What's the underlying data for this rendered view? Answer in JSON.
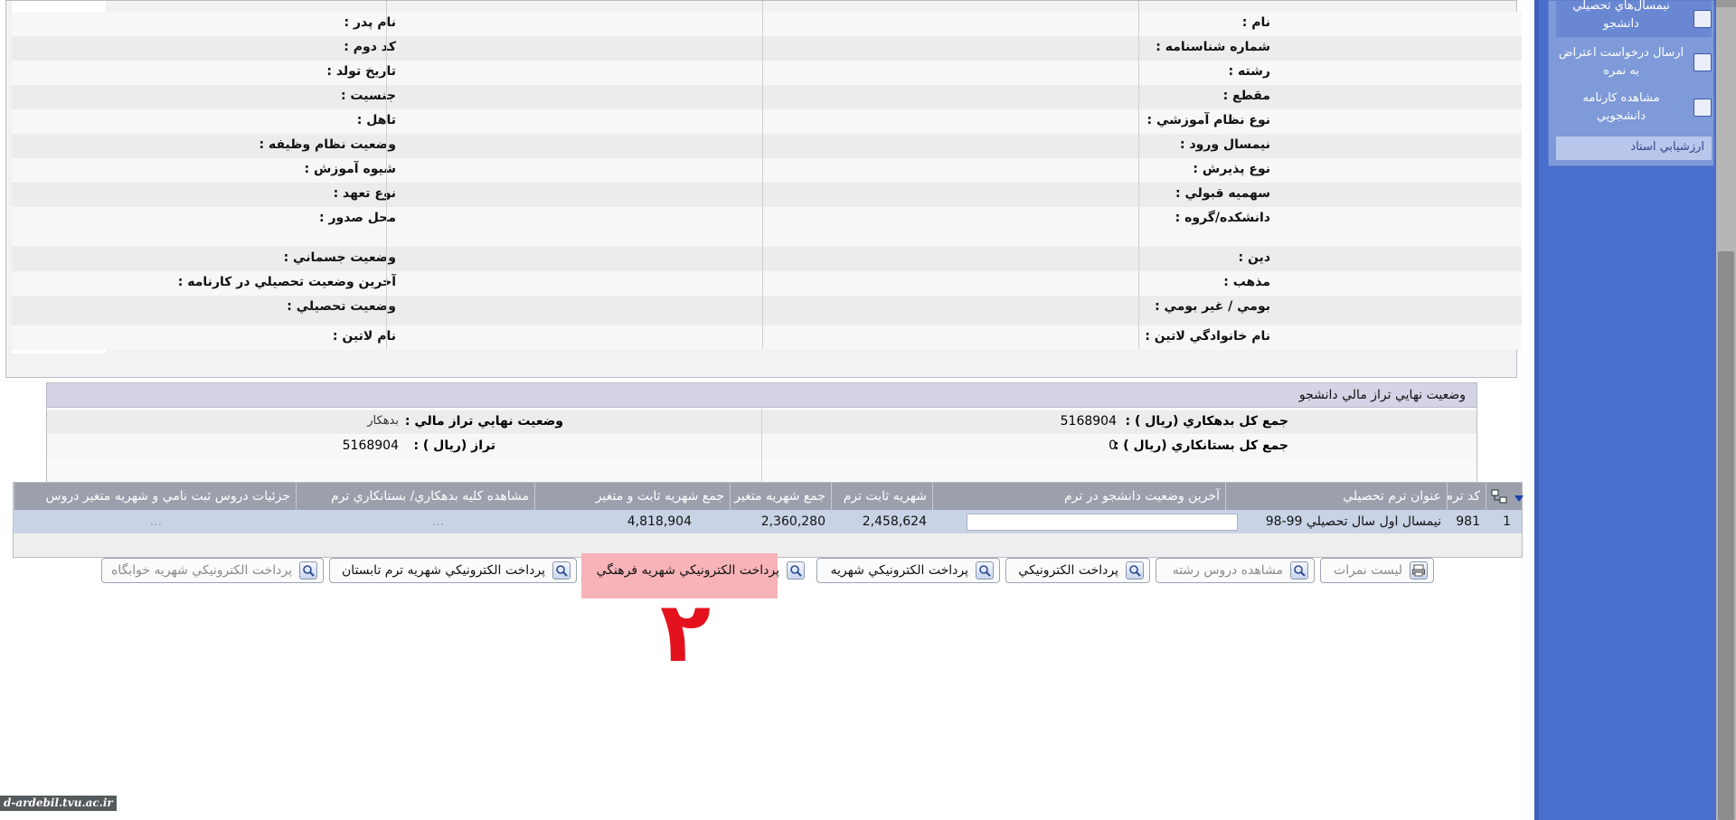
{
  "student_info": {
    "rows": [
      {
        "right_label": "نام :",
        "left_label": "نام پدر :"
      },
      {
        "right_label": "شماره شناسنامه :",
        "left_label": "کد دوم :"
      },
      {
        "right_label": "رشته :",
        "left_label": "تاريخ تولد :"
      },
      {
        "right_label": "مقطع :",
        "left_label": "جنسيت :"
      },
      {
        "right_label": "نوع نظام آموزشي :",
        "left_label": "تاهل :"
      },
      {
        "right_label": "نيمسال ورود :",
        "left_label": "وضعيت نظام وظيفه :"
      },
      {
        "right_label": "نوع پذيرش :",
        "left_label": "شيوه آموزش :"
      },
      {
        "right_label": "سهميه قبولي :",
        "left_label": "نوع تعهد :"
      },
      {
        "right_label": "دانشکده/گروه :",
        "left_label": "محل صدور :"
      },
      {
        "right_label": "دين :",
        "left_label": "وضعيت جسماني :"
      },
      {
        "right_label": "مذهب :",
        "left_label": "آخرين وضعيت تحصيلي در کارنامه :"
      },
      {
        "right_label": "بومي / غير بومي :",
        "left_label": "وضعيت تحصيلي :"
      },
      {
        "right_label": "نام خانوادگي لاتين :",
        "left_label": "نام لاتين :"
      }
    ]
  },
  "finance": {
    "title": "وضعيت نهايي تراز مالي دانشجو",
    "total_debt_label": "جمع کل بدهکاري (ريال ) :",
    "total_debt_value": "5168904",
    "final_status_label": "وضعيت نهايي تراز مالي :",
    "final_status_value": "بدهکار",
    "total_credit_label": "جمع کل بستانکاري (ريال ) :",
    "total_credit_value": "0",
    "balance_label": "تراز (ريال ) :",
    "balance_value": "5168904"
  },
  "term_table": {
    "headers": [
      "کد ترم",
      "عنوان ترم تحصيلي",
      "آخرين وضعيت دانشجو در ترم",
      "شهريه ثابت ترم",
      "جمع شهريه متغير ترم",
      "جمع شهريه ثابت و متغير",
      "مشاهده کليه بدهکاري/ بستانکاري ترم",
      "جزئيات دروس ثبت نامي و شهريه متغير دروس"
    ],
    "row": {
      "index": "1",
      "term_code": "981",
      "term_title": "نيمسال اول سال تحصيلي 99-98",
      "last_status": "",
      "fixed_fee": "2,458,624",
      "variable_fee": "2,360,280",
      "total_fee": "4,818,904",
      "view_debts": "...",
      "course_details": "..."
    }
  },
  "buttons": {
    "grades_list": "ليست نمرات",
    "view_courses": "مشاهده دروس رشته",
    "epay": "پرداخت الکترونيکي",
    "epay_tuition": "پرداخت الکترونيکي شهريه",
    "epay_cultural": "پرداخت الکترونيکي شهريه فرهنگي",
    "epay_summer": "پرداخت الکترونيکي شهريه ترم تابستان",
    "epay_dorm": "پرداخت الکترونيکي شهريه خوابگاه"
  },
  "annotation": {
    "step_number": "۲",
    "highlight_color": "#f7b3b8",
    "number_color": "#e3121d"
  },
  "sidebar": {
    "items": [
      {
        "label": "نيمسال‌هاي تحصيلي دانشجو"
      },
      {
        "label": "ارسال درخواست اعتراض به نمره"
      },
      {
        "label": "مشاهده کارنامه دانشجويي"
      }
    ],
    "selected_item": "ارزشيابي استاد"
  },
  "watermark": "d-ardebil.tvu.ac.ir",
  "colors": {
    "sidebar": "#4a6ecb",
    "table_header": "#9ca0ad",
    "row_selected": "#c9d3e6"
  }
}
